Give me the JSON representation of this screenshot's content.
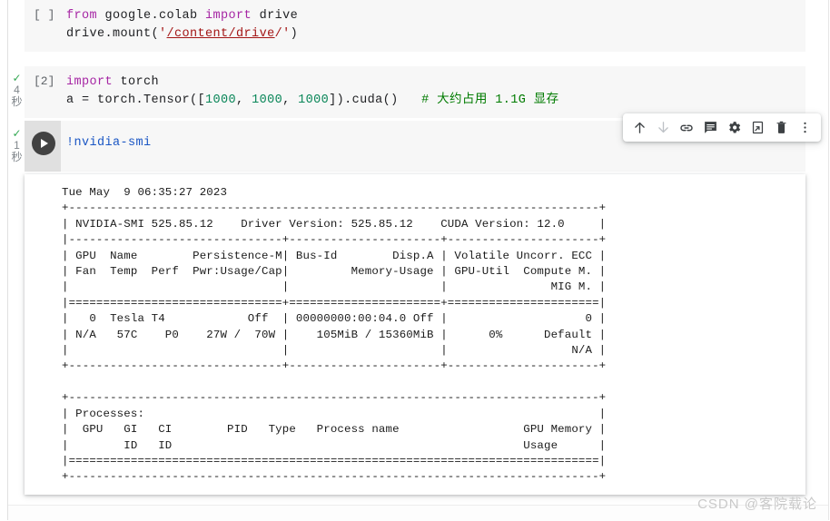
{
  "app": "google-colab-notebook",
  "cells": [
    {
      "id": "cell-1",
      "exec_label": "[ ]",
      "status": null,
      "duration": null,
      "lines": [
        [
          {
            "t": "from",
            "c": "kw"
          },
          {
            "t": " google.colab ",
            "c": ""
          },
          {
            "t": "import",
            "c": "kw"
          },
          {
            "t": " drive",
            "c": ""
          }
        ],
        [
          {
            "t": "drive.mount(",
            "c": ""
          },
          {
            "t": "'/content/drive/'",
            "c": "str"
          },
          {
            "t": ")",
            "c": ""
          }
        ]
      ],
      "code_text": "from google.colab import drive\ndrive.mount('/content/drive/')"
    },
    {
      "id": "cell-2",
      "exec_label": "[2]",
      "status": "check",
      "duration_value": "4",
      "duration_unit": "秒",
      "lines": [
        [
          {
            "t": "import",
            "c": "kw"
          },
          {
            "t": " torch",
            "c": ""
          }
        ],
        [
          {
            "t": "a = torch.Tensor([",
            "c": ""
          },
          {
            "t": "1000",
            "c": "num"
          },
          {
            "t": ", ",
            "c": ""
          },
          {
            "t": "1000",
            "c": "num"
          },
          {
            "t": ", ",
            "c": ""
          },
          {
            "t": "1000",
            "c": "num"
          },
          {
            "t": "]).cuda()   ",
            "c": ""
          },
          {
            "t": "# 大约占用 1.1G 显存",
            "c": "cmt"
          }
        ]
      ],
      "code_text": "import torch\na = torch.Tensor([1000, 1000, 1000]).cuda()   # 大约占用 1.1G 显存"
    },
    {
      "id": "cell-3",
      "exec_label": null,
      "status": "check",
      "duration_value": "1",
      "duration_unit": "秒",
      "lines": [
        [
          {
            "t": "!",
            "c": "shell"
          },
          {
            "t": "nvidia-smi",
            "c": "shell"
          }
        ]
      ],
      "code_text": "!nvidia-smi"
    }
  ],
  "output": {
    "name": "nvidia-smi-output",
    "timestamp": "Tue May  9 06:35:27 2023",
    "header": {
      "smi_version": "NVIDIA-SMI 525.85.12",
      "driver_version": "Driver Version: 525.85.12",
      "cuda_version": "CUDA Version: 12.0"
    },
    "gpu_table_headers_1": [
      "GPU",
      "Name",
      "Persistence-M",
      "Bus-Id",
      "Disp.A",
      "Volatile Uncorr. ECC"
    ],
    "gpu_table_headers_2": [
      "Fan",
      "Temp",
      "Perf",
      "Pwr:Usage/Cap",
      "Memory-Usage",
      "GPU-Util",
      "Compute M."
    ],
    "gpu_table_headers_3": [
      "MIG M."
    ],
    "gpu_row": {
      "index": "0",
      "name": "Tesla T4",
      "persistence_m": "Off",
      "bus_id": "00000000:00:04.0",
      "disp_a": "Off",
      "ecc": "0",
      "fan": "N/A",
      "temp": "57C",
      "perf": "P0",
      "pwr": "27W / 70W",
      "memory": "105MiB / 15360MiB",
      "gpu_util": "0%",
      "compute_m": "Default",
      "mig_m": "N/A"
    },
    "processes_label": "Processes:",
    "processes_headers": [
      "GPU",
      "GI",
      "CI",
      "PID",
      "Type",
      "Process name",
      "GPU Memory"
    ],
    "processes_headers_2": [
      "ID",
      "ID",
      "Usage"
    ],
    "text": "Tue May  9 06:35:27 2023\n+-----------------------------------------------------------------------------+\n| NVIDIA-SMI 525.85.12    Driver Version: 525.85.12    CUDA Version: 12.0     |\n|-------------------------------+----------------------+----------------------+\n| GPU  Name        Persistence-M| Bus-Id        Disp.A | Volatile Uncorr. ECC |\n| Fan  Temp  Perf  Pwr:Usage/Cap|         Memory-Usage | GPU-Util  Compute M. |\n|                               |                      |               MIG M. |\n|===============================+======================+======================|\n|   0  Tesla T4            Off  | 00000000:00:04.0 Off |                    0 |\n| N/A   57C    P0    27W /  70W |    105MiB / 15360MiB |      0%      Default |\n|                               |                      |                  N/A |\n+-------------------------------+----------------------+----------------------+\n                                                                               \n+-----------------------------------------------------------------------------+\n| Processes:                                                                  |\n|  GPU   GI   CI        PID   Type   Process name                  GPU Memory |\n|        ID   ID                                                   Usage      |\n|=============================================================================|\n+-----------------------------------------------------------------------------+"
  },
  "cell_toolbar": {
    "name": "cell-actions-toolbar",
    "buttons": [
      {
        "name": "move-cell-up-button",
        "icon": "arrow-up-icon",
        "label": "Move cell up",
        "enabled": true
      },
      {
        "name": "move-cell-down-button",
        "icon": "arrow-down-icon",
        "label": "Move cell down",
        "enabled": false
      },
      {
        "name": "copy-cell-link-button",
        "icon": "link-icon",
        "label": "Copy link to cell",
        "enabled": true
      },
      {
        "name": "add-comment-button",
        "icon": "comment-icon",
        "label": "Add comment",
        "enabled": true
      },
      {
        "name": "cell-settings-button",
        "icon": "gear-icon",
        "label": "Cell settings",
        "enabled": true
      },
      {
        "name": "mirror-cell-button",
        "icon": "mirror-cell-icon",
        "label": "Mirror cell in tab",
        "enabled": true
      },
      {
        "name": "delete-cell-button",
        "icon": "trash-icon",
        "label": "Delete cell",
        "enabled": true
      },
      {
        "name": "more-cell-actions-button",
        "icon": "more-vert-icon",
        "label": "More cell actions",
        "enabled": true
      }
    ]
  },
  "watermark": {
    "text": "CSDN @客院载论"
  }
}
